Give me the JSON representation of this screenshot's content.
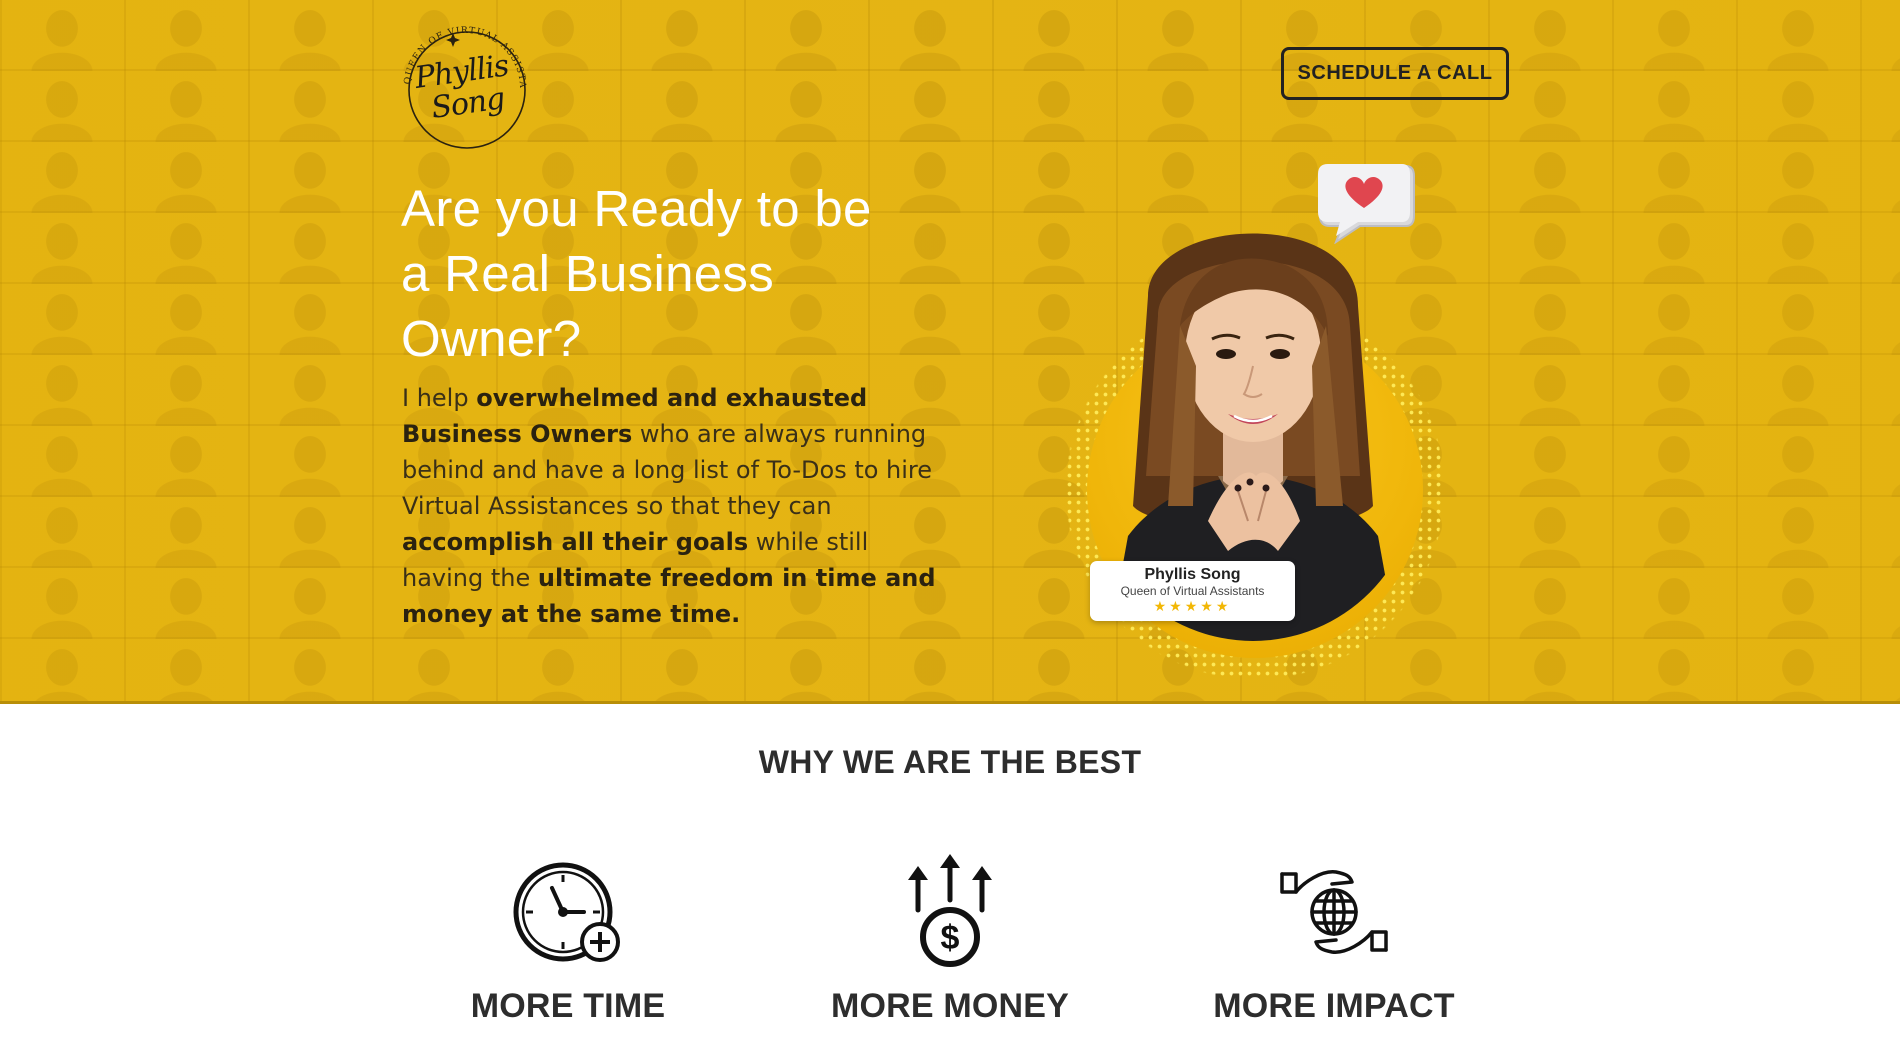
{
  "brand": {
    "logo_name_line1": "Phyllis",
    "logo_name_line2": "Song",
    "logo_ring_text": "QUEEN OF VIRTUAL ASSISTANTS"
  },
  "header": {
    "cta_label": "SCHEDULE A CALL"
  },
  "hero": {
    "headline_line1": "Are you Ready to be",
    "headline_line2": "a Real Business",
    "headline_line3": "Owner?",
    "intro": {
      "t1": "I help ",
      "b1": "overwhelmed and exhausted Business Owners",
      "t2": " who are always running behind and have a long list of To-Dos to hire Virtual Assistances so that they can ",
      "b2": "accomplish all their goals",
      "t3": " while still having the ",
      "b3": "ultimate freedom in time and money at the same time."
    },
    "card": {
      "name": "Phyllis Song",
      "title": "Queen of Virtual Assistants",
      "stars": "★★★★★",
      "rating": 5
    }
  },
  "why": {
    "title": "WHY WE ARE THE BEST",
    "features": [
      {
        "label": "MORE TIME",
        "icon": "clock-plus-icon"
      },
      {
        "label": "MORE MONEY",
        "icon": "money-growth-icon"
      },
      {
        "label": "MORE IMPACT",
        "icon": "hands-globe-icon"
      }
    ]
  },
  "colors": {
    "hero_bg": "#e3b007",
    "text_dark": "#2d2d2d",
    "headline": "#ffffff",
    "accent_star": "#f2b705"
  }
}
